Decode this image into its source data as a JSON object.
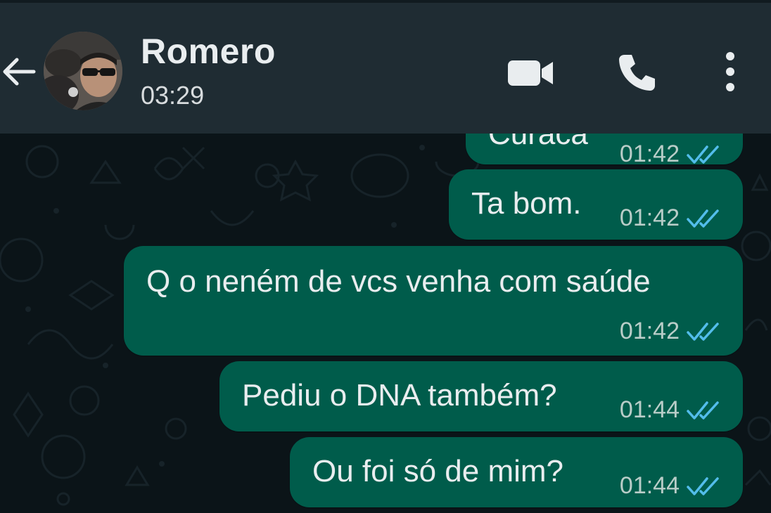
{
  "header": {
    "contact_name": "Romero",
    "status": "03:29",
    "back_icon": "arrow-left-icon",
    "video_icon": "video-camera-icon",
    "call_icon": "phone-icon",
    "menu_icon": "more-vertical-icon"
  },
  "messages": [
    {
      "text": "Curaca",
      "time": "01:42",
      "status_icon": "double-check-icon"
    },
    {
      "text": "Ta bom.",
      "time": "01:42",
      "status_icon": "double-check-icon"
    },
    {
      "text": "Q o neném de vcs venha com saúde",
      "time": "01:42",
      "status_icon": "double-check-icon"
    },
    {
      "text": "Pediu o DNA também?",
      "time": "01:44",
      "status_icon": "double-check-icon"
    },
    {
      "text": "Ou foi só de mim?",
      "time": "01:44",
      "status_icon": "double-check-icon"
    }
  ],
  "colors": {
    "header_bg": "#1f2c33",
    "chat_bg": "#0b1418",
    "outgoing_bubble": "#005c4b",
    "read_tick": "#53bdeb",
    "text": "#e9edef"
  }
}
